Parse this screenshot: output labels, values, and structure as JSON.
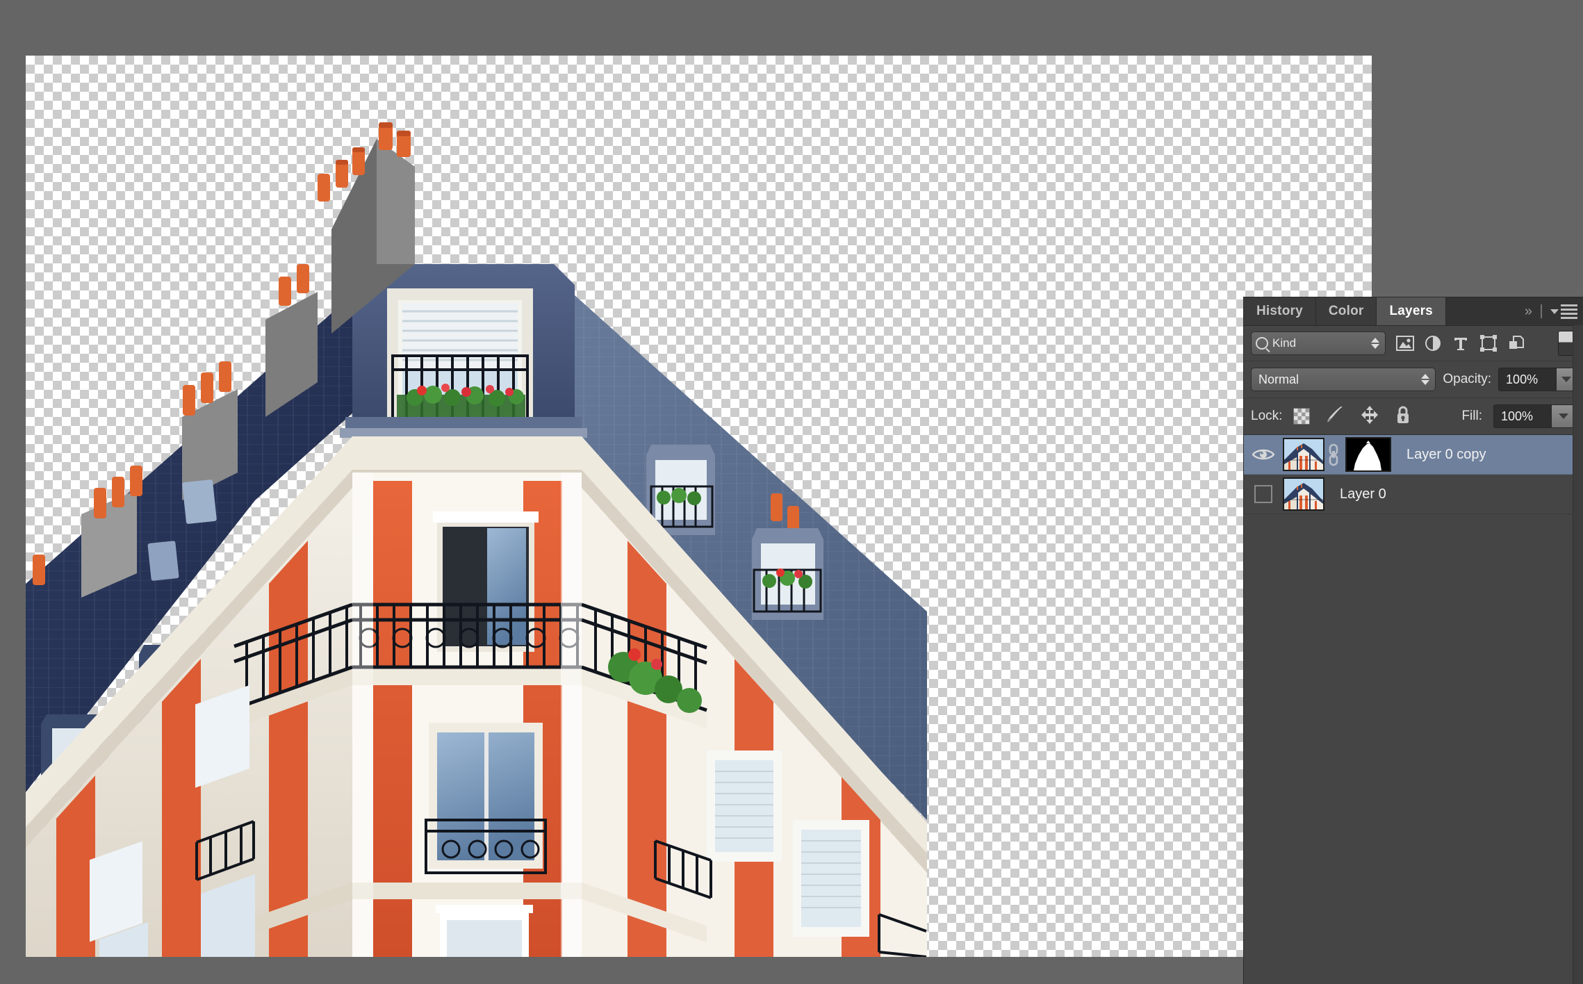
{
  "app": {
    "background_color": "#656565",
    "canvas": {
      "name": "document-canvas",
      "transparency_checker_light": "#ffffff",
      "transparency_checker_dark": "#cccccc",
      "checker_size_px": 13,
      "artwork_description": "Parisian corner apartment building, orange and white striped facade, blue-gray slate mansard roof, terracotta chimney pots, wrought-iron balconies"
    }
  },
  "panel": {
    "tabs": [
      {
        "label": "History",
        "active": false
      },
      {
        "label": "Color",
        "active": false
      },
      {
        "label": "Layers",
        "active": true
      }
    ],
    "header_icons": {
      "collapse": "»",
      "menu": "panel-menu-icon"
    },
    "filter_row": {
      "select_label": "Kind",
      "search_icon": "search-icon",
      "icons": [
        "pixel-layers-filter-icon",
        "adjustment-layers-filter-icon",
        "type-layers-filter-icon",
        "shape-layers-filter-icon",
        "smart-object-filter-icon"
      ],
      "toggle": "filter-enable-toggle"
    },
    "blend_row": {
      "blend_mode": "Normal",
      "opacity_label": "Opacity:",
      "opacity_value": "100%"
    },
    "lock_row": {
      "lock_label": "Lock:",
      "icons": [
        "lock-transparent-pixels-icon",
        "lock-image-pixels-icon",
        "lock-position-icon",
        "lock-all-icon"
      ],
      "fill_label": "Fill:",
      "fill_value": "100%"
    },
    "layers": [
      {
        "name": "Layer 0 copy",
        "visible": true,
        "selected": true,
        "has_mask": true,
        "linked": true,
        "thumbnail": "building-photo-thumbnail",
        "mask_thumbnail": "building-silhouette-mask"
      },
      {
        "name": "Layer 0",
        "visible": false,
        "selected": false,
        "has_mask": false,
        "linked": false,
        "thumbnail": "building-photo-thumbnail"
      }
    ],
    "colors": {
      "panel_bg": "#454545",
      "tab_bar_bg": "#333333",
      "active_tab_bg": "#555555",
      "selected_row_bg": "#6e809c",
      "text": "#f2f2f2"
    }
  }
}
